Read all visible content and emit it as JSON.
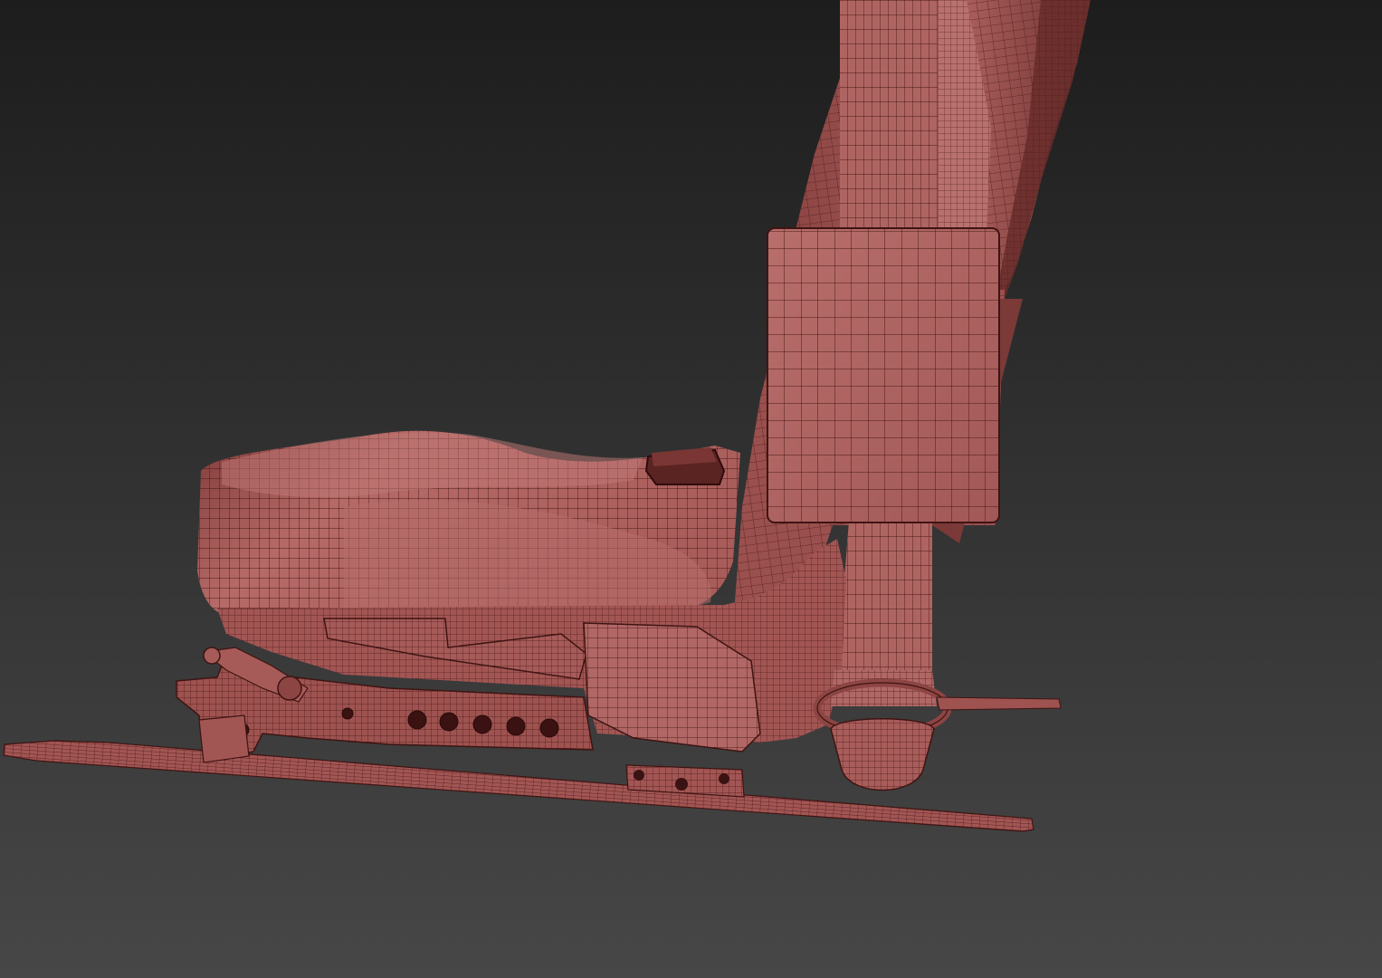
{
  "scene": {
    "subject": "seat-wireframe-render",
    "colors": {
      "bg_top": "#1d1d1d",
      "bg_bottom": "#474747",
      "mesh_fill": "#a85d5b",
      "mesh_fill_light": "#be7471",
      "mesh_fill_dark": "#7e3a38",
      "mesh_shadow": "#5e2a28",
      "wire": "#4a1816"
    }
  }
}
